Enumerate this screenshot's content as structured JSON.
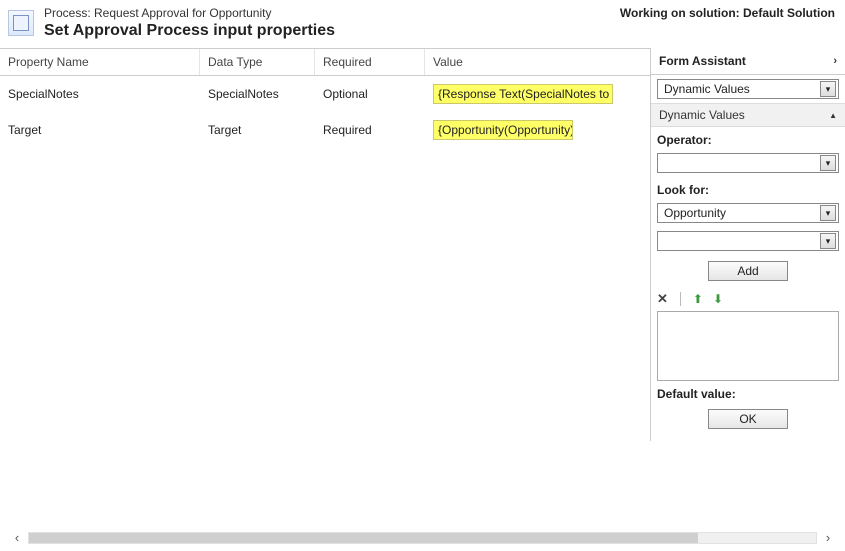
{
  "header": {
    "process_label_prefix": "Process: ",
    "process_name": "Request Approval for Opportunity",
    "title": "Set Approval Process input properties",
    "working_on_prefix": "Working on solution: ",
    "solution_name": "Default Solution"
  },
  "grid": {
    "columns": {
      "property_name": "Property Name",
      "data_type": "Data Type",
      "required": "Required",
      "value": "Value"
    },
    "rows": [
      {
        "property_name": "SpecialNotes",
        "data_type": "SpecialNotes",
        "required": "Optional",
        "value": "{Response Text(SpecialNotes to Manager)}"
      },
      {
        "property_name": "Target",
        "data_type": "Target",
        "required": "Required",
        "value": "{Opportunity(Opportunity)}"
      }
    ]
  },
  "form_assistant": {
    "title": "Form Assistant",
    "dropdown_top": "Dynamic Values",
    "section_title": "Dynamic Values",
    "operator_label": "Operator:",
    "operator_value": "",
    "look_for_label": "Look for:",
    "look_for_value": "Opportunity",
    "look_for_secondary": "",
    "add_label": "Add",
    "default_value_label": "Default value:",
    "ok_label": "OK"
  }
}
